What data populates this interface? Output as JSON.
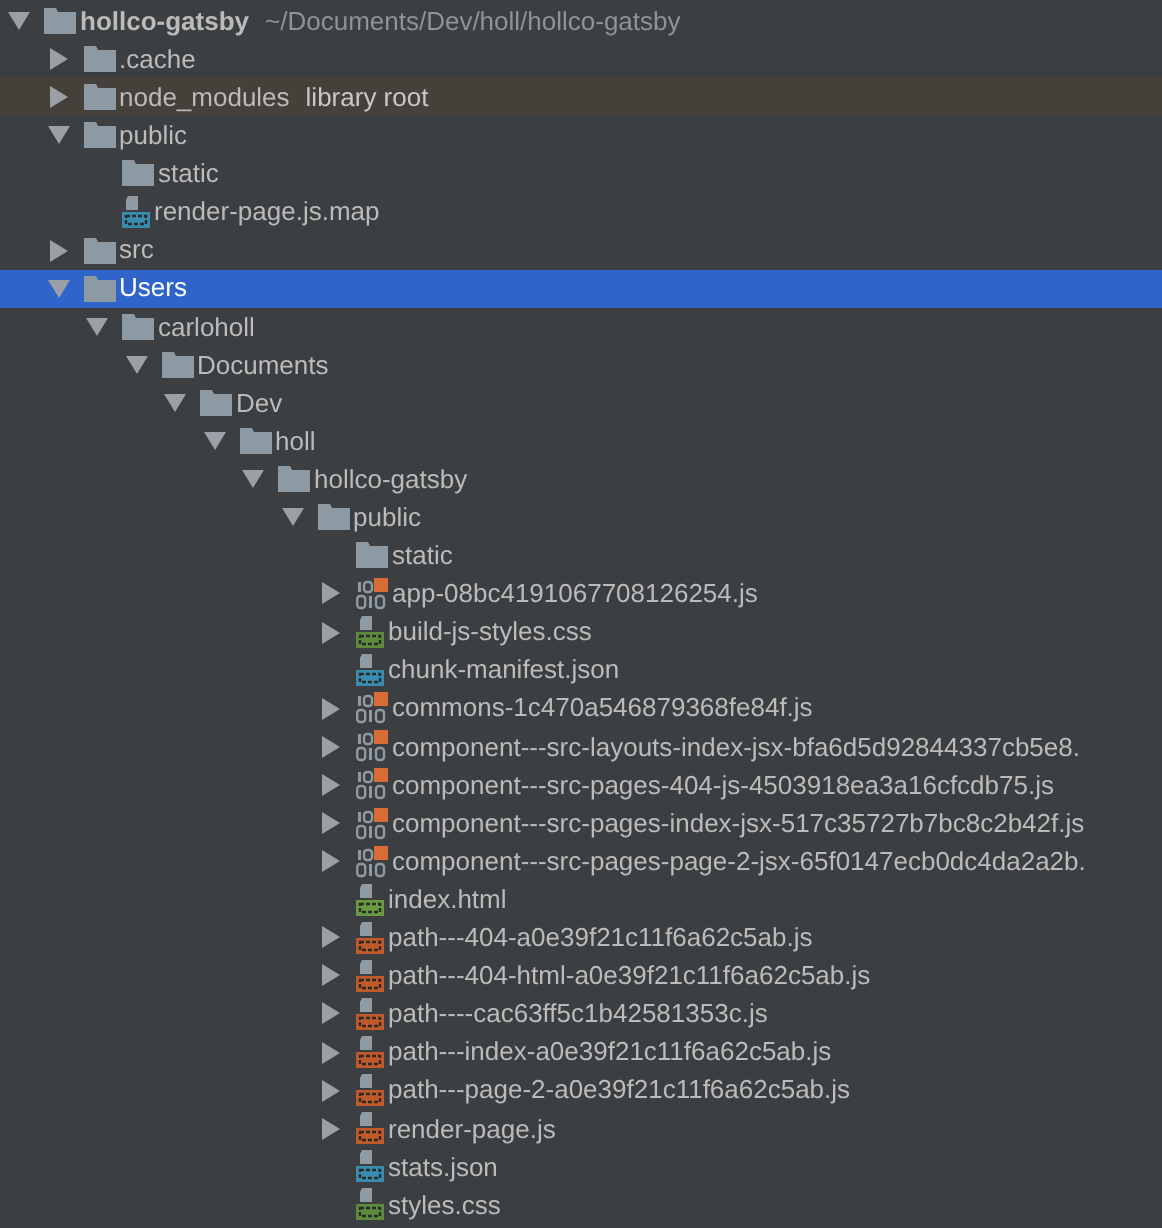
{
  "tree": [
    {
      "label": "hollco-gatsby",
      "path": "~/Documents/Dev/holl/hollco-gatsby",
      "kind": "folder",
      "expanded": true,
      "selected": false,
      "children": [
        {
          "label": ".cache",
          "kind": "folder",
          "expanded": false,
          "selected": false
        },
        {
          "label": "node_modules",
          "note": "library root",
          "highlighted": true,
          "kind": "folder",
          "expanded": false,
          "selected": false
        },
        {
          "label": "public",
          "kind": "folder",
          "expanded": true,
          "selected": false,
          "children": [
            {
              "label": "static",
              "kind": "folder",
              "selected": false
            },
            {
              "label": "render-page.js.map",
              "kind": "json",
              "selected": false
            }
          ]
        },
        {
          "label": "src",
          "kind": "folder",
          "expanded": false,
          "selected": false
        },
        {
          "label": "Users",
          "kind": "folder",
          "expanded": true,
          "selected": true,
          "children": [
            {
              "label": "carloholl",
              "kind": "folder",
              "expanded": true,
              "selected": false,
              "children": [
                {
                  "label": "Documents",
                  "kind": "folder",
                  "expanded": true,
                  "selected": false,
                  "children": [
                    {
                      "label": "Dev",
                      "kind": "folder",
                      "expanded": true,
                      "selected": false,
                      "children": [
                        {
                          "label": "holl",
                          "kind": "folder",
                          "expanded": true,
                          "selected": false,
                          "children": [
                            {
                              "label": "hollco-gatsby",
                              "kind": "folder",
                              "expanded": true,
                              "selected": false,
                              "children": [
                                {
                                  "label": "public",
                                  "kind": "folder",
                                  "expanded": true,
                                  "selected": false,
                                  "children": [
                                    {
                                      "label": "static",
                                      "kind": "folder",
                                      "selected": false
                                    },
                                    {
                                      "label": "app-08bc4191067708126254.js",
                                      "kind": "bundle",
                                      "expanded": false,
                                      "selected": false
                                    },
                                    {
                                      "label": "build-js-styles.css",
                                      "kind": "css",
                                      "expanded": false,
                                      "selected": false
                                    },
                                    {
                                      "label": "chunk-manifest.json",
                                      "kind": "json",
                                      "selected": false
                                    },
                                    {
                                      "label": "commons-1c470a546879368fe84f.js",
                                      "kind": "bundle",
                                      "expanded": false,
                                      "selected": false
                                    },
                                    {
                                      "label": "component---src-layouts-index-jsx-bfa6d5d92844337cb5e8.",
                                      "kind": "bundle",
                                      "expanded": false,
                                      "selected": false
                                    },
                                    {
                                      "label": "component---src-pages-404-js-4503918ea3a16cfcdb75.js",
                                      "kind": "bundle",
                                      "expanded": false,
                                      "selected": false
                                    },
                                    {
                                      "label": "component---src-pages-index-jsx-517c35727b7bc8c2b42f.js",
                                      "kind": "bundle",
                                      "expanded": false,
                                      "selected": false
                                    },
                                    {
                                      "label": "component---src-pages-page-2-jsx-65f0147ecb0dc4da2a2b.",
                                      "kind": "bundle",
                                      "expanded": false,
                                      "selected": false
                                    },
                                    {
                                      "label": "index.html",
                                      "kind": "html",
                                      "selected": false
                                    },
                                    {
                                      "label": "path---404-a0e39f21c11f6a62c5ab.js",
                                      "kind": "js",
                                      "expanded": false,
                                      "selected": false
                                    },
                                    {
                                      "label": "path---404-html-a0e39f21c11f6a62c5ab.js",
                                      "kind": "js",
                                      "expanded": false,
                                      "selected": false
                                    },
                                    {
                                      "label": "path----cac63ff5c1b42581353c.js",
                                      "kind": "js",
                                      "expanded": false,
                                      "selected": false
                                    },
                                    {
                                      "label": "path---index-a0e39f21c11f6a62c5ab.js",
                                      "kind": "js",
                                      "expanded": false,
                                      "selected": false
                                    },
                                    {
                                      "label": "path---page-2-a0e39f21c11f6a62c5ab.js",
                                      "kind": "js",
                                      "expanded": false,
                                      "selected": false
                                    },
                                    {
                                      "label": "render-page.js",
                                      "kind": "js",
                                      "expanded": false,
                                      "selected": false
                                    },
                                    {
                                      "label": "stats.json",
                                      "kind": "json",
                                      "selected": false
                                    },
                                    {
                                      "label": "styles.css",
                                      "kind": "css",
                                      "selected": false
                                    }
                                  ]
                                }
                              ]
                            }
                          ]
                        }
                      ]
                    }
                  ]
                }
              ]
            }
          ]
        }
      ]
    }
  ]
}
